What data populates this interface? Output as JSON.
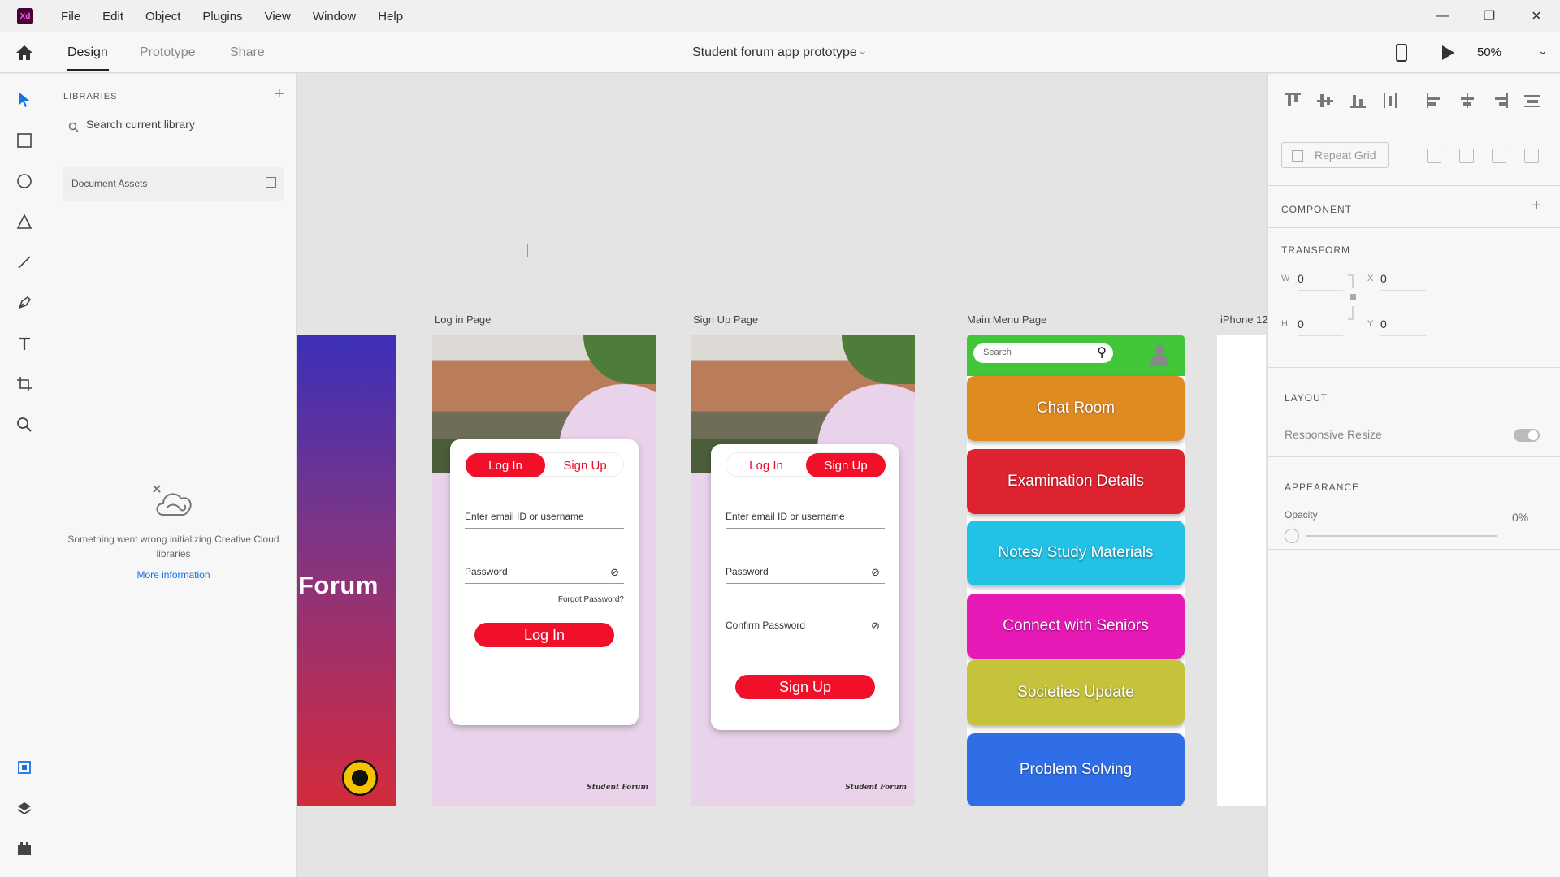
{
  "app": {
    "logo": "Xd",
    "menu": [
      "File",
      "Edit",
      "Object",
      "Plugins",
      "View",
      "Window",
      "Help"
    ],
    "window_controls": {
      "minimize": "—",
      "restore": "❐",
      "close": "✕"
    }
  },
  "toolbar": {
    "tabs": [
      "Design",
      "Prototype",
      "Share"
    ],
    "active_tab": "Design",
    "document_title": "Student forum app prototype",
    "zoom": "50%"
  },
  "tools": [
    "select-tool",
    "rectangle-tool",
    "ellipse-tool",
    "polygon-tool",
    "line-tool",
    "pen-tool",
    "text-tool",
    "artboard-tool",
    "zoom-tool",
    "assets-panel",
    "layers-panel",
    "plugins-panel"
  ],
  "libraries": {
    "title": "LIBRARIES",
    "search_placeholder": "Search current library",
    "document_assets": "Document Assets",
    "error_message": "Something went wrong initializing Creative Cloud libraries",
    "more_info": "More information"
  },
  "canvas": {
    "artboards": {
      "splash": {
        "word": "Forum"
      },
      "login": {
        "label": "Log in Page",
        "tab_login": "Log In",
        "tab_signup": "Sign Up",
        "email_placeholder": "Enter email ID or username",
        "password_placeholder": "Password",
        "forgot": "Forgot Password?",
        "button": "Log In",
        "signature": "Student Forum"
      },
      "signup": {
        "label": "Sign Up Page",
        "tab_login": "Log In",
        "tab_signup": "Sign Up",
        "email_placeholder": "Enter email ID or username",
        "password_placeholder": "Password",
        "confirm_placeholder": "Confirm Password",
        "button": "Sign Up",
        "signature": "Student Forum"
      },
      "main_menu": {
        "label": "Main Menu Page",
        "search_placeholder": "Search",
        "items": [
          {
            "label": "Chat Room",
            "color": "#e08a22"
          },
          {
            "label": "Examination Details",
            "color": "#dd2330"
          },
          {
            "label": "Notes/ Study Materials",
            "color": "#22c1e6"
          },
          {
            "label": "Connect with Seniors",
            "color": "#e71ab8"
          },
          {
            "label": "Societies Update",
            "color": "#c5c23c"
          },
          {
            "label": "Problem Solving",
            "color": "#2f6ee6"
          }
        ],
        "header_color": "#41c63a"
      },
      "iphone": {
        "label": "iPhone 12"
      }
    }
  },
  "inspector": {
    "repeat_grid": "Repeat Grid",
    "component_title": "COMPONENT",
    "transform_title": "TRANSFORM",
    "transform": {
      "w_label": "W",
      "w": "0",
      "h_label": "H",
      "h": "0",
      "x_label": "X",
      "x": "0",
      "y_label": "Y",
      "y": "0"
    },
    "layout_title": "LAYOUT",
    "responsive_resize": "Responsive Resize",
    "appearance_title": "APPEARANCE",
    "opacity_label": "Opacity",
    "opacity": "0%"
  }
}
